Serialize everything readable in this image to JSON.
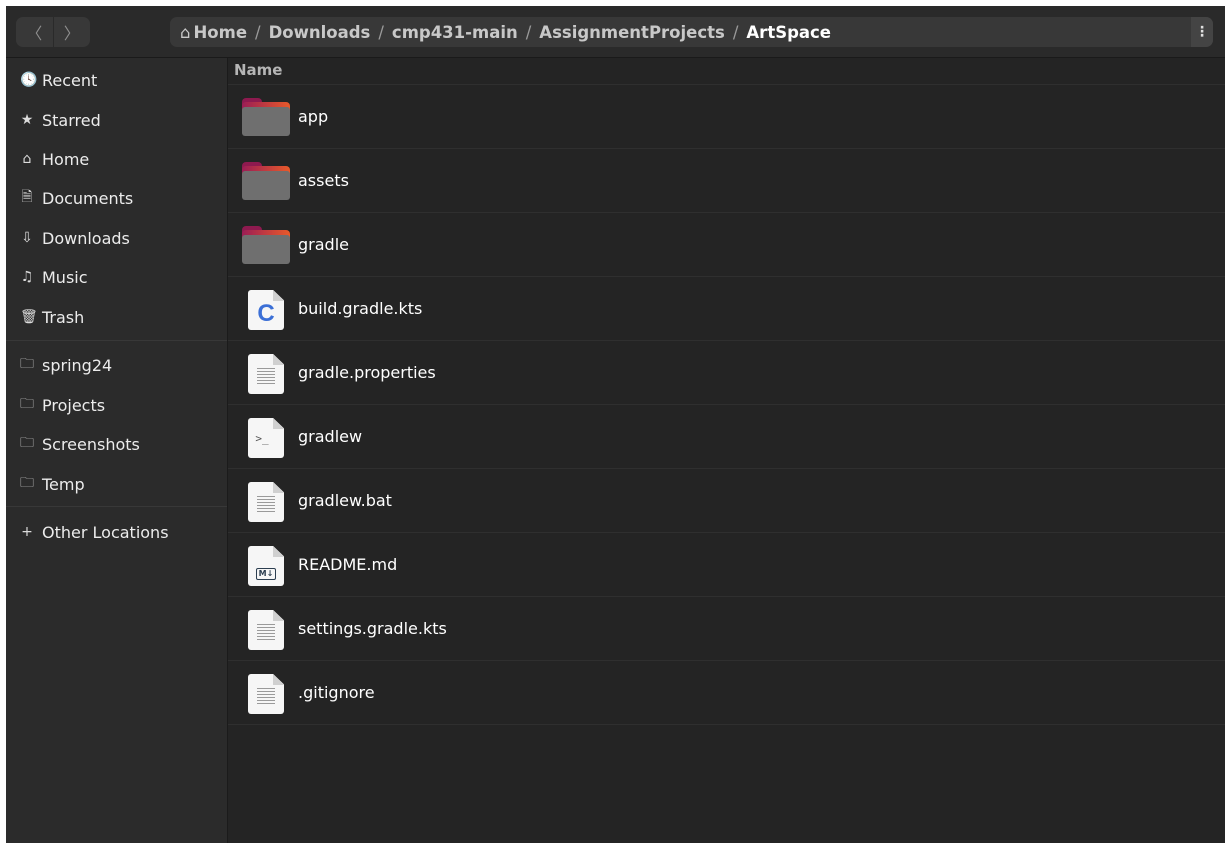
{
  "header": {
    "back_icon": "〈",
    "forward_icon": "〉",
    "home_icon": "⌂",
    "breadcrumbs": [
      "Home",
      "Downloads",
      "cmp431-main",
      "AssignmentProjects",
      "ArtSpace"
    ],
    "separator": "/",
    "menu_icon": "⋮"
  },
  "sidebar": {
    "items": [
      {
        "label": "Recent",
        "icon": "🕓"
      },
      {
        "label": "Starred",
        "icon": "★"
      },
      {
        "label": "Home",
        "icon": "⌂"
      },
      {
        "label": "Documents",
        "icon": "🗎"
      },
      {
        "label": "Downloads",
        "icon": "⇩"
      },
      {
        "label": "Music",
        "icon": "♫"
      },
      {
        "label": "Trash",
        "icon": "🗑"
      }
    ],
    "bookmarks": [
      {
        "label": "spring24",
        "icon": "🗀"
      },
      {
        "label": "Projects",
        "icon": "🗀"
      },
      {
        "label": "Screenshots",
        "icon": "🗀"
      },
      {
        "label": "Temp",
        "icon": "🗀"
      }
    ],
    "other": {
      "label": "Other Locations",
      "icon": "+"
    }
  },
  "main": {
    "column_name": "Name",
    "files": [
      {
        "name": "app",
        "type": "folder"
      },
      {
        "name": "assets",
        "type": "folder"
      },
      {
        "name": "gradle",
        "type": "folder"
      },
      {
        "name": "build.gradle.kts",
        "type": "kotlin"
      },
      {
        "name": "gradle.properties",
        "type": "text"
      },
      {
        "name": "gradlew",
        "type": "script"
      },
      {
        "name": "gradlew.bat",
        "type": "text"
      },
      {
        "name": "README.md",
        "type": "markdown"
      },
      {
        "name": "settings.gradle.kts",
        "type": "text"
      },
      {
        "name": ".gitignore",
        "type": "text"
      }
    ],
    "icon_glyphs": {
      "kotlin": "C",
      "script": ">_",
      "markdown": "M↓"
    }
  }
}
